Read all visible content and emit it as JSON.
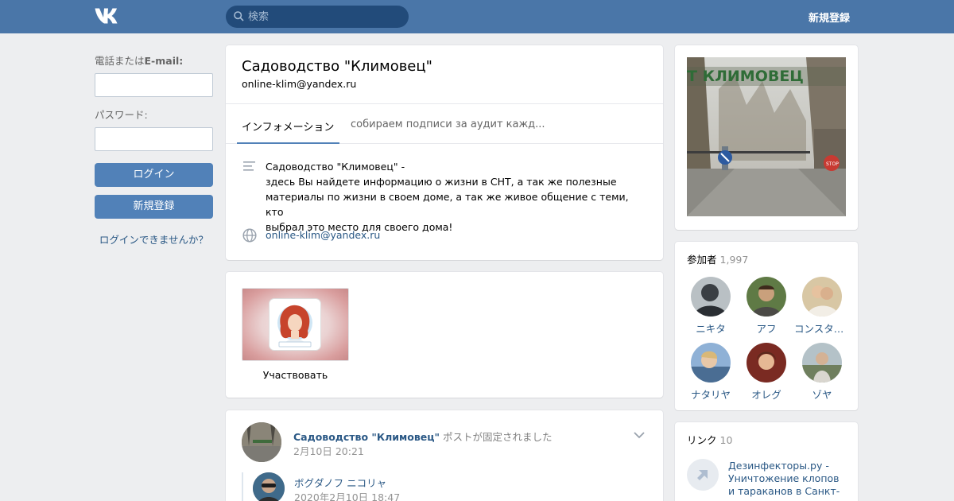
{
  "header": {
    "logo": "VK",
    "search_placeholder": "検索",
    "register_label": "新規登録"
  },
  "login": {
    "phone_label_prefix": "電話または",
    "phone_label_bold": "E-mail:",
    "password_label": "パスワード:",
    "login_button": "ログイン",
    "register_button": "新規登録",
    "forgot_link": "ログインできませんか？"
  },
  "group": {
    "name": "Садоводство \"Климовец\"",
    "status": "online-klim@yandex.ru",
    "tabs": [
      {
        "label": "インフォメーション"
      },
      {
        "label": "собираем подписи за аудит кажд..."
      }
    ],
    "description": "Садоводство \"Климовец\" -\nздесь Вы найдете информацию о жизни в СНТ, а так же полезные\nматериалы по жизни в своем доме, а так же живое общение с теми, кто\nвыбрал это место для своего дома!",
    "site": "online-klim@yandex.ru"
  },
  "app": {
    "label": "Участвовать"
  },
  "post": {
    "author": "Садоводство \"Климовец\"",
    "action": " ポストが固定されました",
    "date": "2月10日 20:21",
    "repost_author": "ボグダノフ ニコリャ",
    "repost_date": "2020年2月10日 18:47"
  },
  "cover": {
    "sign_text": "Т КЛИМОВЕЦ",
    "stop_text": "STOP"
  },
  "members": {
    "title": "参加者",
    "count": "1,997",
    "items": [
      {
        "name": "ニキタ",
        "color": "#3a3f44"
      },
      {
        "name": "アフ",
        "color": "#6b7a5a"
      },
      {
        "name": "コンスタンチン",
        "color": "#c9b592"
      },
      {
        "name": "ナタリヤ",
        "color": "#6f8fb5"
      },
      {
        "name": "オレグ",
        "color": "#7a2a22"
      },
      {
        "name": "ゾヤ",
        "color": "#8b9b8f"
      }
    ]
  },
  "links": {
    "title": "リンク",
    "count": "10",
    "items": [
      {
        "text": "Дезинфекторы.ру - Уничтожение клопов и тараканов в Санкт-"
      }
    ]
  },
  "colors": {
    "header": "#4a76a8",
    "button": "#5181b8",
    "link": "#2a5885",
    "background": "#edeef0"
  }
}
